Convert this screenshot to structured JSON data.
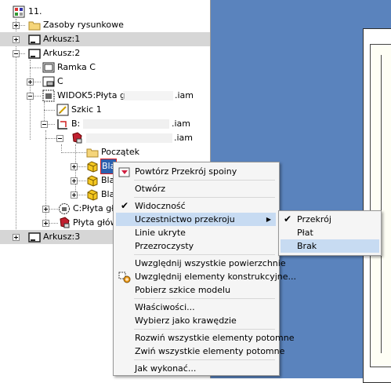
{
  "tree": {
    "root": "11.",
    "items": [
      {
        "label": "Zasoby rysunkowe"
      },
      {
        "label": "Arkusz:1"
      },
      {
        "label": "Arkusz:2"
      },
      {
        "label": "Ramka C"
      },
      {
        "label": "C"
      },
      {
        "label": "WIDOK5:Płyta g",
        "suffix": ".iam"
      },
      {
        "label": "Szkic 1"
      },
      {
        "label": "B:",
        "suffix": ".iam"
      },
      {
        "label": "",
        "suffix": ".iam"
      },
      {
        "label": "Początek"
      },
      {
        "label": "Bla"
      },
      {
        "label": "Bla"
      },
      {
        "label": "Bla"
      },
      {
        "label": "C:Płyta głó"
      },
      {
        "label": "Płyta główn"
      },
      {
        "label": "Arkusz:3"
      }
    ]
  },
  "context_menu": {
    "items": [
      {
        "label": "Powtórz Przekrój spoiny",
        "icon": "repeat-weld-section-icon"
      },
      {
        "label": "Otwórz"
      },
      {
        "label": "Widoczność",
        "checked": true
      },
      {
        "label": "Uczestnictwo przekroju",
        "submenu": true
      },
      {
        "label": "Linie ukryte"
      },
      {
        "label": "Przezroczysty"
      },
      {
        "label": "Uwzględnij wszystkie powierzchnie"
      },
      {
        "label": "Uwzględnij elementy konstrukcyjne...",
        "icon": "construction-elements-icon"
      },
      {
        "label": "Pobierz szkice modelu"
      },
      {
        "label": "Właściwości..."
      },
      {
        "label": "Wybierz jako krawędzie"
      },
      {
        "label": "Rozwiń wszystkie elementy potomne"
      },
      {
        "label": "Zwiń wszystkie elementy potomne"
      },
      {
        "label": "Jak wykonać..."
      }
    ]
  },
  "submenu": {
    "items": [
      {
        "label": "Przekrój",
        "checked": true
      },
      {
        "label": "Płat"
      },
      {
        "label": "Brak"
      }
    ]
  },
  "colors": {
    "viewport": "#5a83bd",
    "menu_highlight": "#c7dbf2",
    "tree_highlight": "#d6d6d6",
    "selection_border": "#e02020"
  }
}
